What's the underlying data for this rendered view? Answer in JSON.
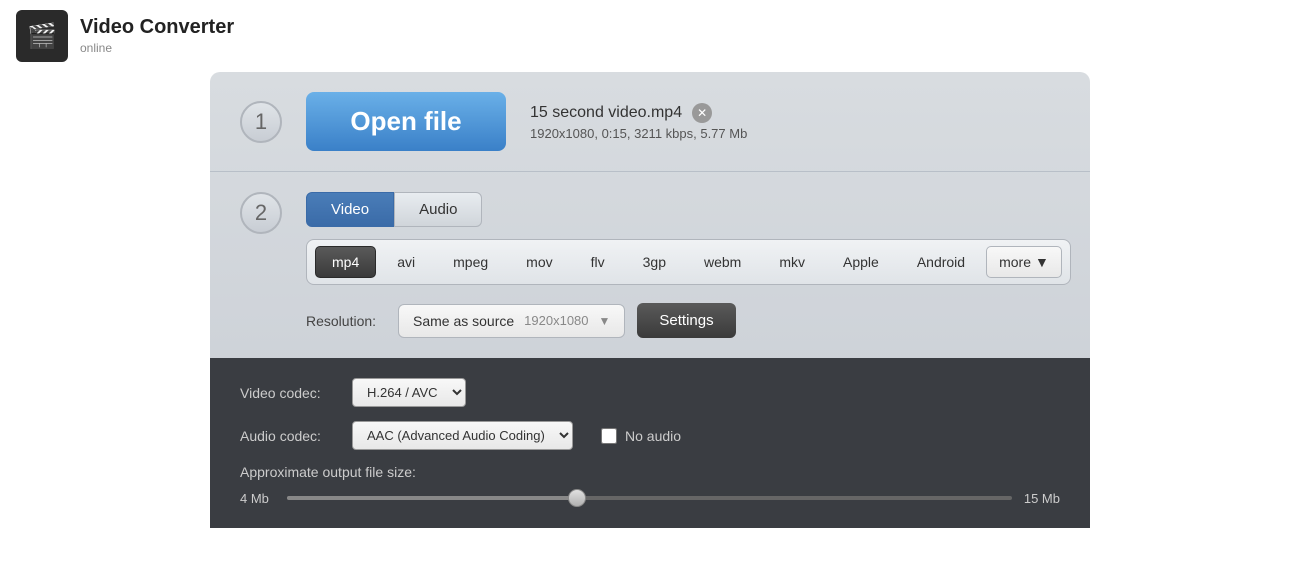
{
  "header": {
    "title": "Video Converter",
    "subtitle": "online"
  },
  "step1": {
    "number": "1",
    "open_button_label": "Open file",
    "file_name": "15 second video.mp4",
    "file_meta": "1920x1080, 0:15, 3211 kbps, 5.77 Mb"
  },
  "step2": {
    "number": "2",
    "tabs": [
      {
        "label": "Video",
        "active": true
      },
      {
        "label": "Audio",
        "active": false
      }
    ],
    "formats": [
      {
        "label": "mp4",
        "selected": true
      },
      {
        "label": "avi",
        "selected": false
      },
      {
        "label": "mpeg",
        "selected": false
      },
      {
        "label": "mov",
        "selected": false
      },
      {
        "label": "flv",
        "selected": false
      },
      {
        "label": "3gp",
        "selected": false
      },
      {
        "label": "webm",
        "selected": false
      },
      {
        "label": "mkv",
        "selected": false
      },
      {
        "label": "Apple",
        "selected": false
      },
      {
        "label": "Android",
        "selected": false
      }
    ],
    "more_label": "more",
    "resolution_label": "Resolution:",
    "resolution_value": "Same as source",
    "resolution_detail": "1920x1080",
    "settings_button_label": "Settings"
  },
  "settings": {
    "video_codec_label": "Video codec:",
    "video_codec_value": "H.264 / AVC",
    "audio_codec_label": "Audio codec:",
    "audio_codec_value": "AAC (Advanced Audio Coding)",
    "no_audio_label": "No audio",
    "approx_label": "Approximate output file size:",
    "size_min": "4 Mb",
    "size_max": "15 Mb"
  }
}
